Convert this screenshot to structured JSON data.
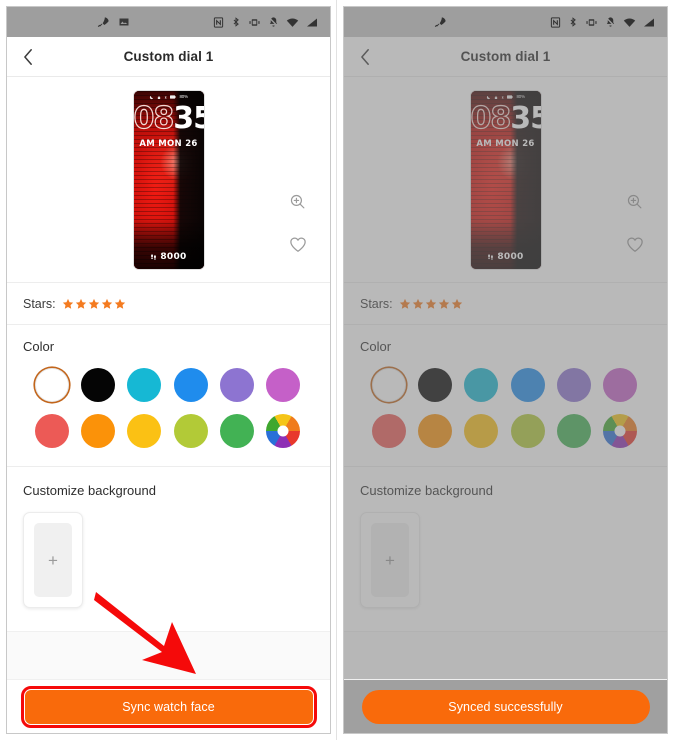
{
  "panels": [
    {
      "id": "before",
      "statusbar": {
        "left_icons": [
          "rocket-icon",
          "image-icon"
        ],
        "right_icons": [
          "nfc-icon",
          "bluetooth-icon",
          "vibrate-icon",
          "bell-muted-icon",
          "wifi-icon",
          "signal-icon"
        ]
      },
      "appbar": {
        "back": "back-chevron-icon",
        "title": "Custom dial 1"
      },
      "preview": {
        "watch": {
          "hour": "08",
          "minute": "35",
          "date": "AM MON 26",
          "battery": "80%",
          "steps": "8000",
          "steps_icon": "footsteps-icon",
          "status_icons": [
            "moon-icon",
            "lock-icon",
            "bluetooth-icon",
            "battery-icon"
          ]
        },
        "actions": [
          {
            "name": "zoom-in-icon",
            "label": "Zoom"
          },
          {
            "name": "heart-icon",
            "label": "Favorite"
          }
        ]
      },
      "stars": {
        "label": "Stars:",
        "count": 5,
        "color": "#f47b20"
      },
      "color": {
        "title": "Color",
        "selected_index": 0,
        "swatches": [
          {
            "name": "white",
            "hex": "#ffffff"
          },
          {
            "name": "black",
            "hex": "#050505"
          },
          {
            "name": "cyan",
            "hex": "#16b8d4"
          },
          {
            "name": "blue",
            "hex": "#1f8ced"
          },
          {
            "name": "purple",
            "hex": "#8d74d1"
          },
          {
            "name": "magenta",
            "hex": "#c560c8"
          },
          {
            "name": "coral-red",
            "hex": "#ec5a56"
          },
          {
            "name": "orange",
            "hex": "#fb9209"
          },
          {
            "name": "gold",
            "hex": "#fbc114"
          },
          {
            "name": "yellow-green",
            "hex": "#b2ca37"
          },
          {
            "name": "green",
            "hex": "#42b254"
          },
          {
            "name": "color-wheel",
            "hex": "wheel"
          }
        ]
      },
      "background": {
        "title": "Customize background",
        "add_glyph": "+"
      },
      "footer": {
        "button_label": "Sync watch face",
        "button_color": "#f96a0b",
        "highlighted": true
      },
      "annotation": {
        "type": "arrow",
        "color": "#f50a0a",
        "points_to": "sync-watch-face-button"
      }
    },
    {
      "id": "after",
      "statusbar": {
        "left_icons": [
          "rocket-icon"
        ],
        "right_icons": [
          "nfc-icon",
          "bluetooth-icon",
          "vibrate-icon",
          "bell-muted-icon",
          "wifi-icon",
          "signal-icon"
        ]
      },
      "appbar": {
        "back": "back-chevron-icon",
        "title": "Custom dial 1"
      },
      "preview": {
        "watch": {
          "hour": "08",
          "minute": "35",
          "date": "AM MON 26",
          "battery": "80%",
          "steps": "8000",
          "steps_icon": "footsteps-icon",
          "status_icons": [
            "moon-icon",
            "lock-icon",
            "bluetooth-icon",
            "battery-icon"
          ]
        },
        "actions": [
          {
            "name": "zoom-in-icon",
            "label": "Zoom"
          },
          {
            "name": "heart-icon",
            "label": "Favorite"
          }
        ]
      },
      "stars": {
        "label": "Stars:",
        "count": 5,
        "color": "#f47b20"
      },
      "color": {
        "title": "Color",
        "selected_index": 0,
        "swatches": [
          {
            "name": "white",
            "hex": "#ffffff"
          },
          {
            "name": "black",
            "hex": "#050505"
          },
          {
            "name": "cyan",
            "hex": "#16b8d4"
          },
          {
            "name": "blue",
            "hex": "#1f8ced"
          },
          {
            "name": "purple",
            "hex": "#8d74d1"
          },
          {
            "name": "magenta",
            "hex": "#c560c8"
          },
          {
            "name": "coral-red",
            "hex": "#ec5a56"
          },
          {
            "name": "orange",
            "hex": "#fb9209"
          },
          {
            "name": "gold",
            "hex": "#fbc114"
          },
          {
            "name": "yellow-green",
            "hex": "#b2ca37"
          },
          {
            "name": "green",
            "hex": "#42b254"
          },
          {
            "name": "color-wheel",
            "hex": "wheel"
          }
        ]
      },
      "background": {
        "title": "Customize background",
        "add_glyph": "+"
      },
      "footer": {
        "button_label": "Synced successfully",
        "button_color": "#f96a0b",
        "highlighted": false
      },
      "dimmed": true
    }
  ]
}
